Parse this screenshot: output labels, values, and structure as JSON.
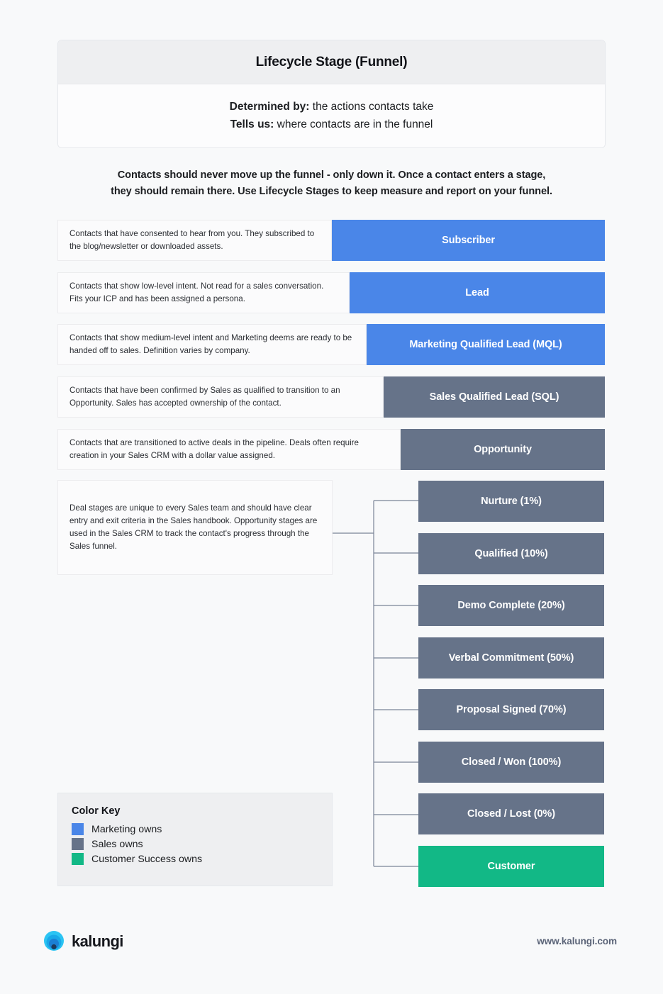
{
  "header": {
    "title": "Lifecycle Stage (Funnel)",
    "determined_by_label": "Determined by:",
    "determined_by_value": " the actions contacts take",
    "tells_us_label": "Tells us:",
    "tells_us_value": " where contacts are in the funnel"
  },
  "intro": {
    "line1": "Contacts should never move up the funnel - only down it. Once a contact enters a stage,",
    "line2": "they should remain there. Use Lifecycle Stages to keep measure and report on your funnel."
  },
  "colors": {
    "marketing_blue": "#4a86e8",
    "sales_gray": "#667389",
    "customer_success_green": "#12b886",
    "page_background": "#f8f9fa",
    "card_background": "#fbfbfc",
    "card_header_background": "#eeeff1",
    "border": "#e6e8ec",
    "connector_line": "#7a8496"
  },
  "funnel_rows": [
    {
      "description": "Contacts that have consented to hear from you. They subscribed to the blog/newsletter or downloaded assets.",
      "stage": "Subscriber",
      "owner": "Marketing owns",
      "color": "#4a86e8"
    },
    {
      "description": "Contacts that show low-level intent. Not read for a sales conversation. Fits your ICP and has been assigned a persona.",
      "stage": "Lead",
      "owner": "Marketing owns",
      "color": "#4a86e8"
    },
    {
      "description": "Contacts that show medium-level intent and Marketing deems are ready to be handed off to sales. Definition varies by company.",
      "stage": "Marketing Qualified Lead (MQL)",
      "owner": "Marketing owns",
      "color": "#4a86e8"
    },
    {
      "description": "Contacts that have been confirmed by Sales as qualified to transition to an Opportunity. Sales has accepted ownership of the contact.",
      "stage": "Sales Qualified Lead (SQL)",
      "owner": "Sales owns",
      "color": "#667389"
    },
    {
      "description": "Contacts that are transitioned to active deals in the pipeline. Deals often require creation in your Sales CRM with a dollar value assigned.",
      "stage": "Opportunity",
      "owner": "Sales owns",
      "color": "#667389"
    }
  ],
  "deal_stages_note": {
    "description": "Deal stages are unique to every Sales team and should have clear entry and exit criteria in the Sales handbook. Opportunity stages are used in the Sales CRM to track the contact's progress through the Sales funnel."
  },
  "deal_stages": [
    {
      "label": "Nurture (1%)",
      "percent": 1,
      "color": "#667389",
      "owner": "Sales owns"
    },
    {
      "label": "Qualified (10%)",
      "percent": 10,
      "color": "#667389",
      "owner": "Sales owns"
    },
    {
      "label": "Demo Complete (20%)",
      "percent": 20,
      "color": "#667389",
      "owner": "Sales owns"
    },
    {
      "label": "Verbal Commitment (50%)",
      "percent": 50,
      "color": "#667389",
      "owner": "Sales owns"
    },
    {
      "label": "Proposal Signed (70%)",
      "percent": 70,
      "color": "#667389",
      "owner": "Sales owns"
    },
    {
      "label": "Closed / Won (100%)",
      "percent": 100,
      "color": "#667389",
      "owner": "Sales owns"
    },
    {
      "label": "Closed / Lost (0%)",
      "percent": 0,
      "color": "#667389",
      "owner": "Sales owns"
    },
    {
      "label": "Customer",
      "percent": null,
      "color": "#12b886",
      "owner": "Customer Success owns"
    }
  ],
  "color_key": {
    "title": "Color Key",
    "items": [
      {
        "label": "Marketing owns",
        "color": "#4a86e8"
      },
      {
        "label": "Sales owns",
        "color": "#667389"
      },
      {
        "label": "Customer Success owns",
        "color": "#12b886"
      }
    ]
  },
  "footer": {
    "brand": "kalungi",
    "url": "www.kalungi.com"
  }
}
